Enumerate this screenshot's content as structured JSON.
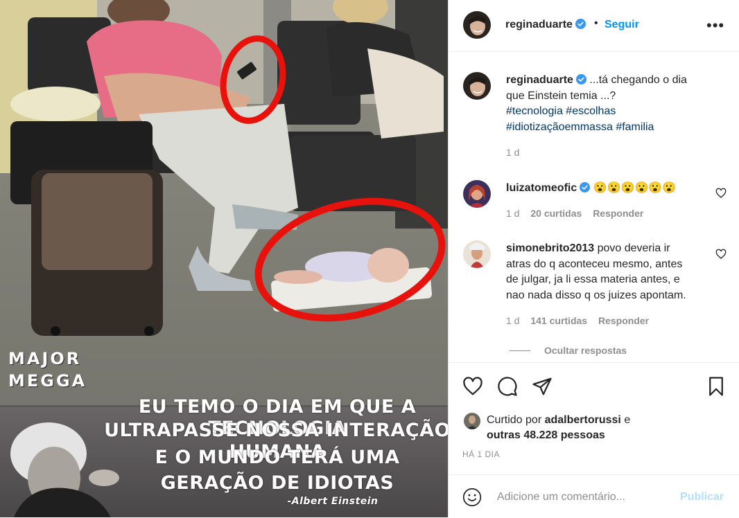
{
  "post": {
    "username": "reginaduarte",
    "follow_label": "Seguir",
    "separator": "•",
    "more_icon": "more-options-icon",
    "more_label": "•••"
  },
  "image": {
    "brand_line1": "MAJOR",
    "brand_line2": "MEGGA",
    "quote_line1": "EU TEMO O DIA EM QUE A TECNOLOGIA",
    "quote_line2": "ULTRAPASSE NOSSA INTERAÇÃO HUMANA",
    "quote_line3": "E O MUNDO TERÁ UMA",
    "quote_line4": "GERAÇÃO DE IDIOTAS",
    "quote_author": "-Albert Einstein"
  },
  "caption": {
    "username": "reginaduarte",
    "text_line1": "...tá chegando o dia",
    "text_line2": "que Einstein temia ...?",
    "tag1": "#tecnologia",
    "tag2": "#escolhas",
    "tag3": "#idiotizaçãoemmassa",
    "tag4": "#familia",
    "time": "1 d"
  },
  "comments": [
    {
      "username": "luizatomeofic",
      "text": "😮😮😮😮😮😮",
      "time": "1 d",
      "likes": "20 curtidas",
      "reply": "Responder"
    },
    {
      "username": "simonebrito2013",
      "text_line1": "povo deveria ir",
      "text_line2": "atras do q aconteceu mesmo, antes",
      "text_line3": "de julgar, ja li essa materia antes, e",
      "text_line4": "nao nada disso q os juizes apontam.",
      "time": "1 d",
      "likes": "141 curtidas",
      "reply": "Responder"
    }
  ],
  "hide_replies": "Ocultar respostas",
  "likes": {
    "prefix": "Curtido por",
    "user": "adalbertorussi",
    "mid": "e",
    "others": "outras 48.228 pessoas"
  },
  "time_ago": "HÁ 1 DIA",
  "add_comment": {
    "placeholder": "Adicione um comentário...",
    "post_label": "Publicar"
  },
  "colors": {
    "accent": "#0095f6",
    "hashtag": "#00376b",
    "muted": "#8e8e8e",
    "highlight_circle": "#e8120c"
  }
}
